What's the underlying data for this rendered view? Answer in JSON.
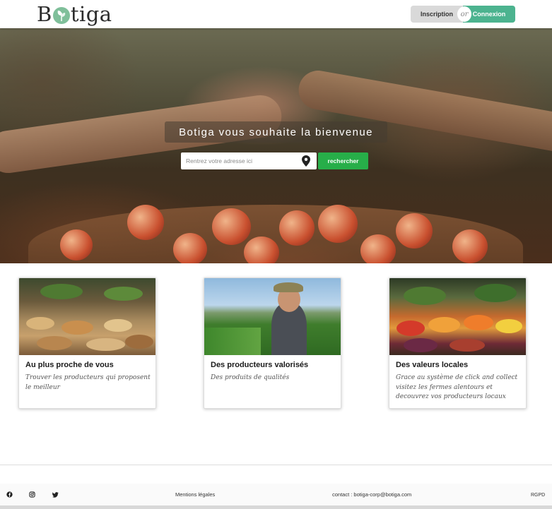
{
  "header": {
    "logo_text_pre": "B",
    "logo_text_post": "tiga",
    "signup_label": "Inscription",
    "or_label": "or",
    "login_label": "Connexion",
    "accent_color": "#4cb38f"
  },
  "hero": {
    "title": "Botiga vous souhaite la bienvenue",
    "search_placeholder": "Rentrez votre adresse ici",
    "search_button": "rechercher",
    "button_color": "#27ae49"
  },
  "cards": [
    {
      "title": "Au plus proche de vous",
      "text": "Trouver les producteurs qui proposent le meilleur"
    },
    {
      "title": "Des producteurs valorisés",
      "text": "Des produits de qualités"
    },
    {
      "title": "Des valeurs locales",
      "text": "Grace au système de click and collect visitez les fermes alentours et decouvrez vos producteurs locaux"
    }
  ],
  "footer": {
    "icons": [
      "facebook-icon",
      "instagram-icon",
      "twitter-icon"
    ],
    "legal": "Mentions légales",
    "contact": "contact : botiga-corp@botiga.com",
    "rgpd": "RGPD"
  }
}
